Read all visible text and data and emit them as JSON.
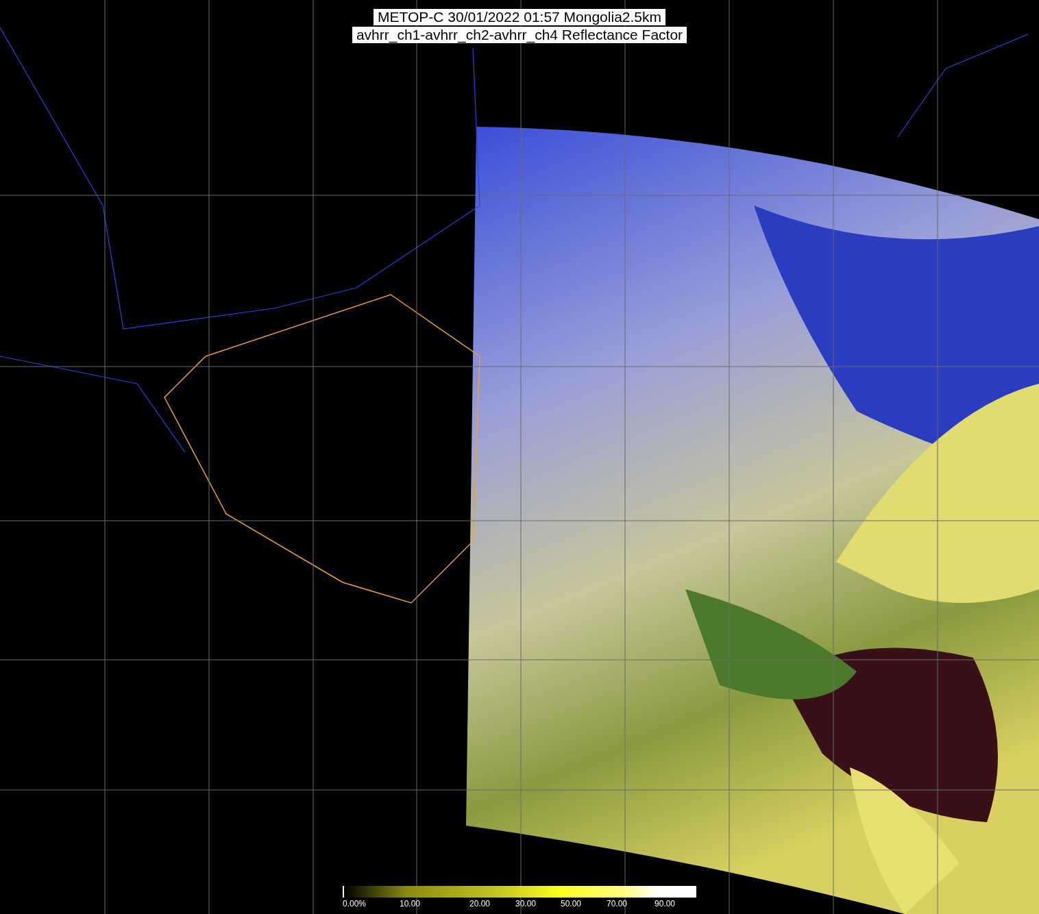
{
  "title": {
    "line_1": "METOP-C 30/01/2022 01:57 Mongolia2.5km",
    "line_2": "avhrr_ch1-avhrr_ch2-avhrr_ch4 Reflectance Factor"
  },
  "legend": {
    "labels": [
      "0.00%",
      "10.00",
      "20.00",
      "30.00",
      "50.00",
      "70.00",
      "90.00"
    ]
  }
}
